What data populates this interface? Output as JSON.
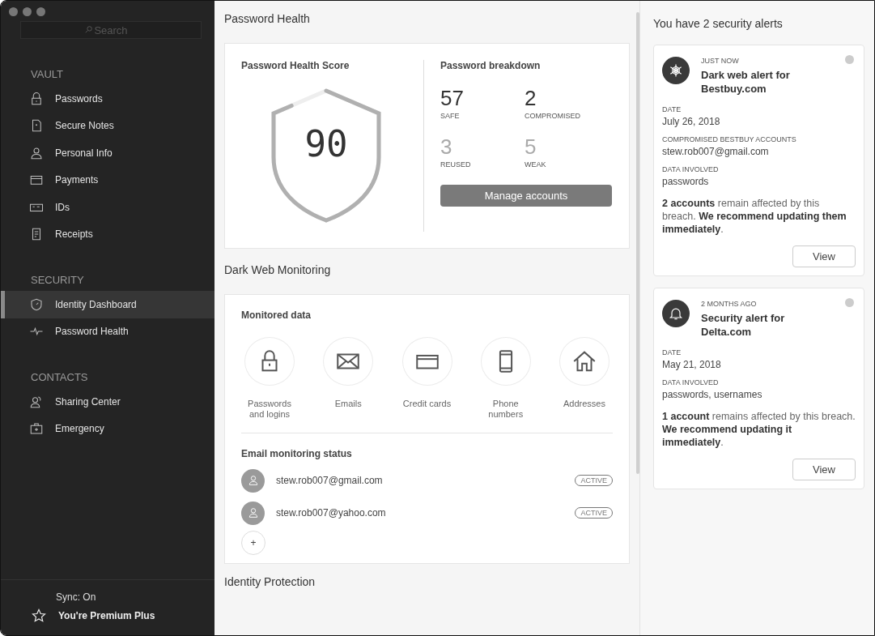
{
  "sidebar": {
    "search": {
      "placeholder": "Search"
    },
    "sections": [
      {
        "title": "VAULT",
        "items": [
          {
            "label": "Passwords",
            "selected": false
          },
          {
            "label": "Secure Notes",
            "selected": false
          },
          {
            "label": "Personal Info",
            "selected": false
          },
          {
            "label": "Payments",
            "selected": false
          },
          {
            "label": "IDs",
            "selected": false
          },
          {
            "label": "Receipts",
            "selected": false
          }
        ]
      },
      {
        "title": "SECURITY",
        "items": [
          {
            "label": "Identity Dashboard",
            "selected": true
          },
          {
            "label": "Password Health",
            "selected": false
          }
        ]
      },
      {
        "title": "CONTACTS",
        "items": [
          {
            "label": "Sharing Center",
            "selected": false
          },
          {
            "label": "Emergency",
            "selected": false
          }
        ]
      }
    ],
    "sync": "Sync: On",
    "plan": "You're Premium Plus"
  },
  "password_health": {
    "heading": "Password Health",
    "score_title": "Password Health Score",
    "score": "90",
    "breakdown_title": "Password breakdown",
    "stats": [
      {
        "value": "57",
        "label": "SAFE",
        "muted": false
      },
      {
        "value": "2",
        "label": "COMPROMISED",
        "muted": false
      },
      {
        "value": "3",
        "label": "REUSED",
        "muted": true
      },
      {
        "value": "5",
        "label": "WEAK",
        "muted": true
      }
    ],
    "button": "Manage accounts"
  },
  "dark_web": {
    "heading": "Dark Web Monitoring",
    "monitored_title": "Monitored data",
    "monitored": [
      "Passwords and logins",
      "Emails",
      "Credit cards",
      "Phone numbers",
      "Addresses"
    ],
    "email_title": "Email monitoring status",
    "emails": [
      {
        "address": "stew.rob007@gmail.com",
        "status": "ACTIVE"
      },
      {
        "address": "stew.rob007@yahoo.com",
        "status": "ACTIVE"
      }
    ],
    "add_button": "+"
  },
  "next_heading": "Identity Protection",
  "alerts": {
    "heading": "You have 2 security alerts",
    "items": [
      {
        "time": "JUST NOW",
        "title": "Dark web alert for Bestbuy.com",
        "fields": [
          {
            "label": "DATE",
            "value": "July 26, 2018"
          },
          {
            "label": "COMPROMISED BESTBUY ACCOUNTS",
            "value": "stew.rob007@gmail.com"
          },
          {
            "label": "DATA INVOLVED",
            "value": "passwords"
          }
        ],
        "message": "**2 accounts** remain affected by this breach. **We recommend updating them immediately**.",
        "button": "View"
      },
      {
        "time": "2 MONTHS AGO",
        "title": "Security alert for Delta.com",
        "fields": [
          {
            "label": "DATE",
            "value": "May 21, 2018"
          },
          {
            "label": "DATA INVOLVED",
            "value": "passwords, usernames"
          }
        ],
        "message": "**1 account** remains affected by this breach. **We recommend updating it immediately**.",
        "button": "View"
      }
    ]
  }
}
